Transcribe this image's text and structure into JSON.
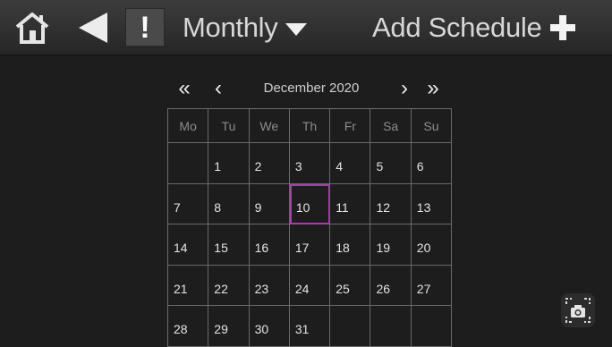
{
  "topbar": {
    "home_icon": "home-icon",
    "back_icon": "back-triangle-icon",
    "alert_label": "!",
    "view_label": "Monthly",
    "view_icon": "caret-down-icon",
    "add_label": "Add Schedule",
    "add_icon": "plus-icon"
  },
  "calendar": {
    "month_title": "December 2020",
    "prev_year": "«",
    "prev_month": "‹",
    "next_month": "›",
    "next_year": "»",
    "weekdays": [
      "Mo",
      "Tu",
      "We",
      "Th",
      "Fr",
      "Sa",
      "Su"
    ],
    "weeks": [
      [
        "",
        "1",
        "2",
        "3",
        "4",
        "5",
        "6"
      ],
      [
        "7",
        "8",
        "9",
        "10",
        "11",
        "12",
        "13"
      ],
      [
        "14",
        "15",
        "16",
        "17",
        "18",
        "19",
        "20"
      ],
      [
        "21",
        "22",
        "23",
        "24",
        "25",
        "26",
        "27"
      ],
      [
        "28",
        "29",
        "30",
        "31",
        "",
        "",
        ""
      ]
    ],
    "selected_day": "10",
    "selected_color": "#a23ea6"
  },
  "screenshot_icon": "camera-icon"
}
